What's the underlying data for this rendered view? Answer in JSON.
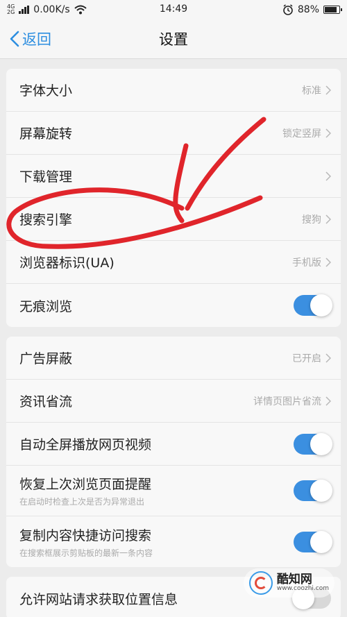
{
  "status_bar": {
    "network_top": "4G",
    "network_bottom": "2G",
    "speed": "0.00K/s",
    "time": "14:49",
    "battery": "88%",
    "battery_level": 0.88
  },
  "nav": {
    "back_label": "返回",
    "title": "设置"
  },
  "groups": [
    {
      "rows": [
        {
          "label": "字体大小",
          "value": "标准"
        },
        {
          "label": "屏幕旋转",
          "value": "锁定竖屏"
        },
        {
          "label": "下载管理",
          "value": ""
        },
        {
          "label": "搜索引擎",
          "value": "搜狗"
        },
        {
          "label": "浏览器标识(UA)",
          "value": "手机版"
        },
        {
          "label": "无痕浏览",
          "toggle": true
        }
      ]
    },
    {
      "rows": [
        {
          "label": "广告屏蔽",
          "value": "已开启"
        },
        {
          "label": "资讯省流",
          "value": "详情页图片省流"
        },
        {
          "label": "自动全屏播放网页视频",
          "toggle": true
        },
        {
          "label": "恢复上次浏览页面提醒",
          "sub": "在启动时检查上次是否为异常退出",
          "toggle": true
        },
        {
          "label": "复制内容快捷访问搜索",
          "sub": "在搜索框展示剪贴板的最新一条内容",
          "toggle": true
        }
      ]
    },
    {
      "rows": [
        {
          "label": "允许网站请求获取位置信息",
          "toggle": false
        }
      ]
    }
  ],
  "watermark": {
    "name": "酷知网",
    "url": "www.coozhi.com"
  },
  "colors": {
    "accent": "#2d8ee0",
    "toggle_on": "#3b8fe0",
    "annotation": "#e0252b"
  }
}
